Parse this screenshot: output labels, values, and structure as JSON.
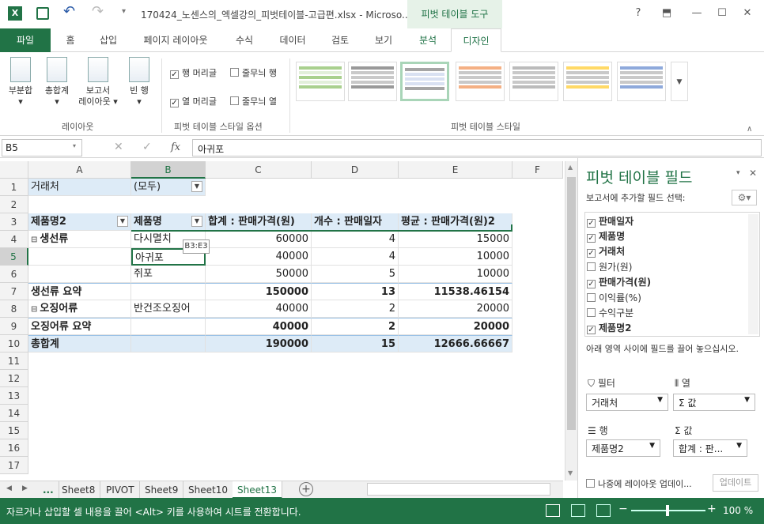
{
  "titlebar": {
    "title": "170424_노센스의_엑셀강의_피벗테이블-고급편.xlsx - Microso...",
    "context_tool": "피벗 테이블 도구",
    "help": "?"
  },
  "tabs": [
    "파일",
    "홈",
    "삽입",
    "페이지 레이아웃",
    "수식",
    "데이터",
    "검토",
    "보기",
    "분석",
    "디자인"
  ],
  "ribbon": {
    "layout_buttons": [
      "부분합",
      "총합계",
      "보고서\n레이아웃",
      "빈 행"
    ],
    "layout_group": "레이아웃",
    "options": {
      "row_headers": "행 머리글",
      "banded_rows": "줄무늬 행",
      "col_headers": "열 머리글",
      "banded_cols": "줄무늬 열"
    },
    "options_group": "피벗 테이블 스타일 옵션",
    "styles_group": "피벗 테이블 스타일"
  },
  "formula_bar": {
    "name_box": "B5",
    "fx": "fx",
    "value": "아귀포"
  },
  "columns": [
    "A",
    "B",
    "C",
    "D",
    "E",
    "F"
  ],
  "rows": [
    "1",
    "2",
    "3",
    "4",
    "5",
    "6",
    "7",
    "8",
    "9",
    "10",
    "11",
    "12",
    "13",
    "14",
    "15",
    "16",
    "17"
  ],
  "cells": {
    "a1": "거래처",
    "b1": "(모두)",
    "a3": "제품명2",
    "b3": "제품명",
    "c3": "합계 : 판매가격(원)",
    "d3": "개수 : 판매일자",
    "e3": "평균 : 판매가격(원)2",
    "a4": "생선류",
    "b4": "다시멸치",
    "c4": "60000",
    "d4": "4",
    "e4": "15000",
    "b5": "아귀포",
    "c5": "40000",
    "d5": "4",
    "e5": "10000",
    "b6": "쥐포",
    "c6": "50000",
    "d6": "5",
    "e6": "10000",
    "a7": "생선류 요약",
    "c7": "150000",
    "d7": "13",
    "e7": "11538.46154",
    "a8": "오징어류",
    "b8": "반건조오징어",
    "c8": "40000",
    "d8": "2",
    "e8": "20000",
    "a9": "오징어류 요약",
    "c9": "40000",
    "d9": "2",
    "e9": "20000",
    "a10": "총합계",
    "c10": "190000",
    "d10": "15",
    "e10": "12666.66667"
  },
  "tooltip": "B3:E3",
  "sheets": [
    "...",
    "Sheet8",
    "PIVOT",
    "Sheet9",
    "Sheet10",
    "Sheet13"
  ],
  "pane": {
    "title": "피벗 테이블 필드",
    "subtitle": "보고서에 추가할 필드 선택:",
    "fields": [
      {
        "label": "판매일자",
        "checked": true
      },
      {
        "label": "제품명",
        "checked": true
      },
      {
        "label": "거래처",
        "checked": true
      },
      {
        "label": "원가(원)",
        "checked": false
      },
      {
        "label": "판매가격(원)",
        "checked": true
      },
      {
        "label": "이익률(%)",
        "checked": false
      },
      {
        "label": "수익구분",
        "checked": false
      },
      {
        "label": "제품명2",
        "checked": true
      }
    ],
    "drag_hint": "아래 영역 사이에 필드를 끌어 놓으십시오.",
    "filter_label": "필터",
    "filter_value": "거래처",
    "columns_label": "열",
    "columns_value": "Σ 값",
    "rows_label": "행",
    "rows_value": "제품명2",
    "values_label": "Σ 값",
    "values_value": "합계 : 판...",
    "defer_label": "나중에 레이아웃 업데이...",
    "update_button": "업데이트"
  },
  "status": {
    "message": "자르거나 삽입할 셀 내용을 끌어 <Alt> 키를 사용하여 시트를 전환합니다.",
    "zoom": "100 %"
  },
  "colors": {
    "accent": "#217346",
    "header_fill": "#ddebf7",
    "context": "#e6f2e8"
  }
}
